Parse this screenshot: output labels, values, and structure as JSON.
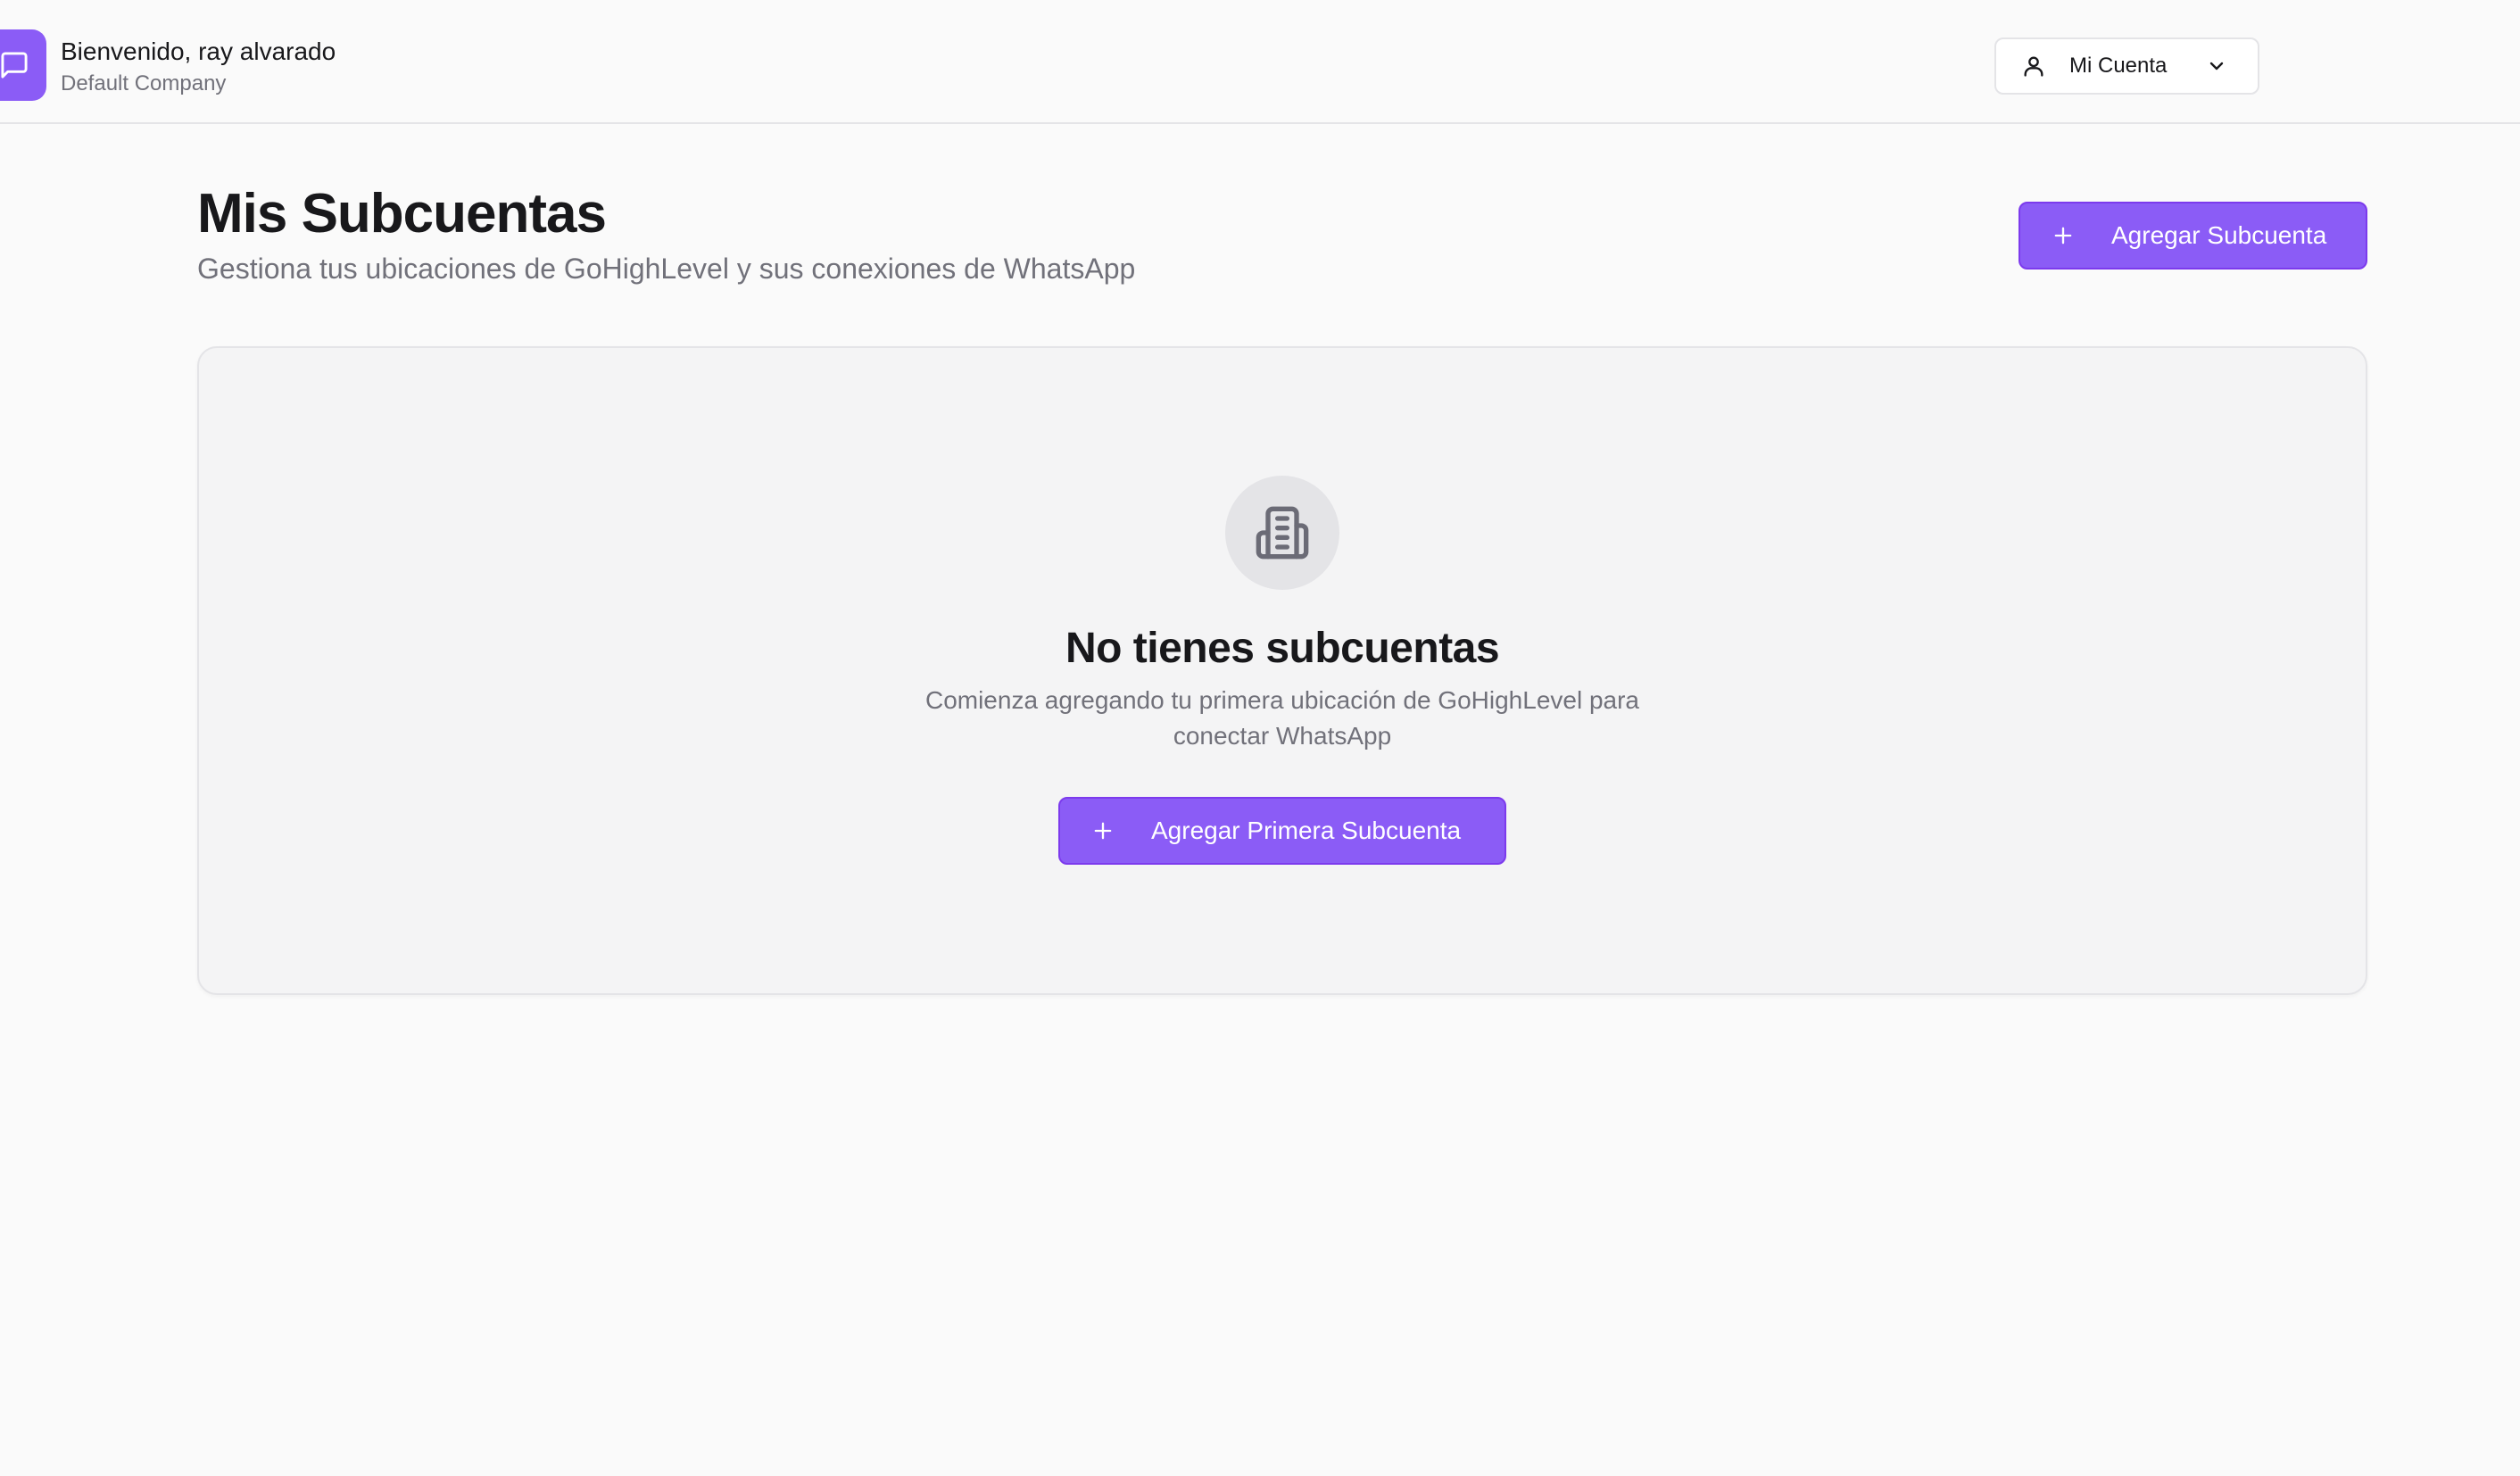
{
  "header": {
    "welcome": "Bienvenido, ray alvarado",
    "company": "Default Company",
    "account_label": "Mi Cuenta"
  },
  "main": {
    "title": "Mis Subcuentas",
    "subtitle": "Gestiona tus ubicaciones de GoHighLevel y sus conexiones de WhatsApp",
    "add_button": "Agregar Subcuenta"
  },
  "empty_state": {
    "title": "No tienes subcuentas",
    "description_line1": "Comienza agregando tu primera ubicación de GoHighLevel para",
    "description_line2": "conectar WhatsApp",
    "button": "Agregar Primera Subcuenta"
  },
  "colors": {
    "accent": "#8b5cf6",
    "background": "#fafafa",
    "card": "#f4f4f5"
  },
  "icons": {
    "logo": "message-square-icon",
    "account": "user-icon",
    "dropdown": "chevron-down-icon",
    "add": "plus-icon",
    "empty": "building-icon"
  }
}
